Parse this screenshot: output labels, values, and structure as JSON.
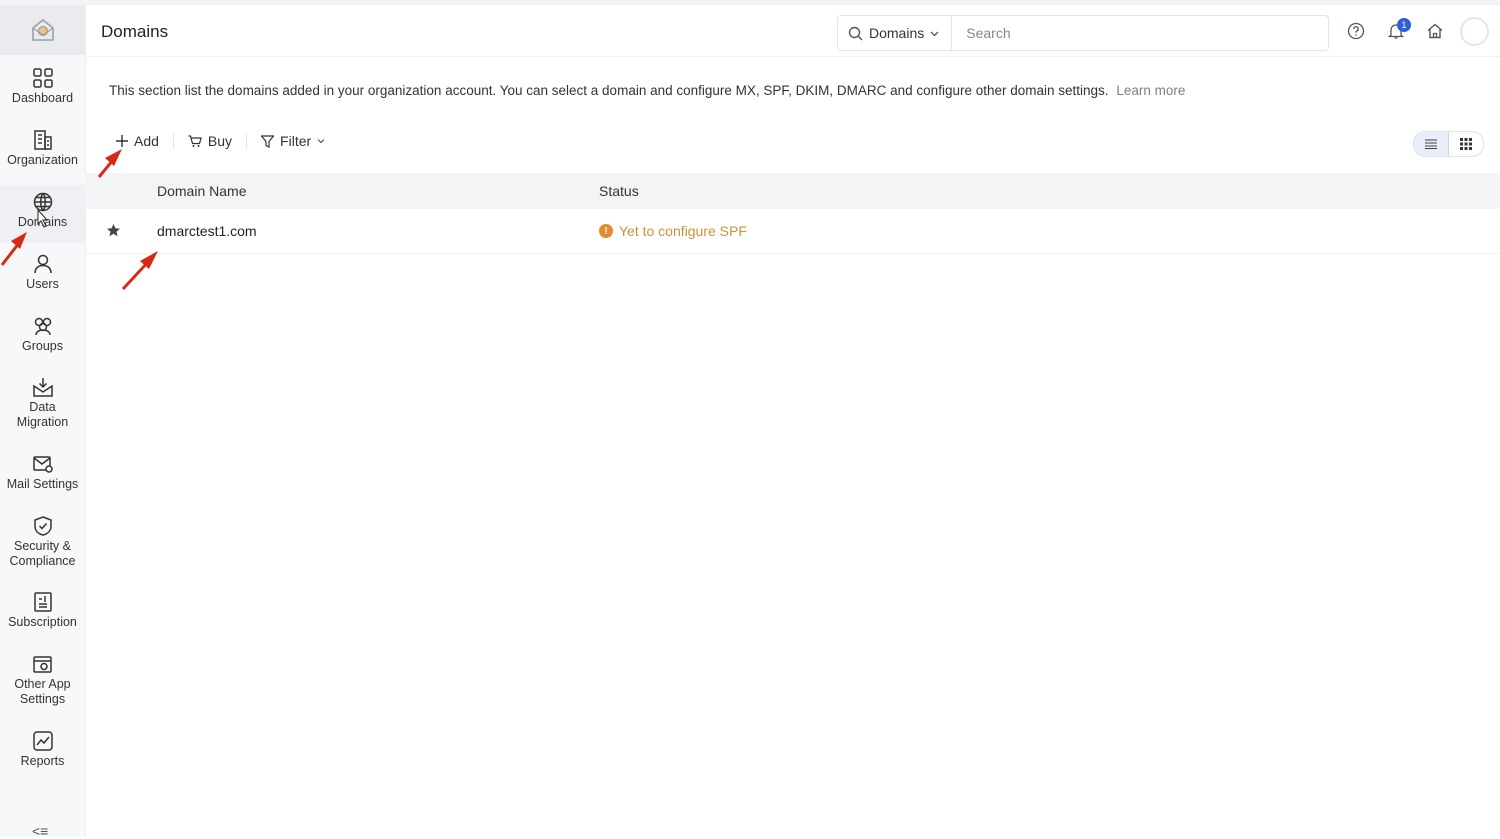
{
  "header": {
    "title": "Domains",
    "search_scope": "Domains",
    "search_placeholder": "Search",
    "notification_count": "1"
  },
  "sidebar": {
    "items": [
      {
        "label": "Dashboard",
        "icon": "dashboard-icon"
      },
      {
        "label": "Organization",
        "icon": "building-icon"
      },
      {
        "label": "Domains",
        "icon": "globe-icon"
      },
      {
        "label": "Users",
        "icon": "user-icon"
      },
      {
        "label": "Groups",
        "icon": "group-icon"
      },
      {
        "label": "Data Migration",
        "icon": "migration-icon"
      },
      {
        "label": "Mail Settings",
        "icon": "mail-settings-icon"
      },
      {
        "label": "Security & Compliance",
        "icon": "shield-icon"
      },
      {
        "label": "Subscription",
        "icon": "subscription-icon"
      },
      {
        "label": "Other App Settings",
        "icon": "app-settings-icon"
      },
      {
        "label": "Reports",
        "icon": "reports-icon"
      }
    ],
    "active": "Domains"
  },
  "main": {
    "description": "This section list the domains added in your organization account. You can select a domain and configure MX, SPF, DKIM, DMARC and configure other domain settings.",
    "learn_more": "Learn more",
    "toolbar": {
      "add": "Add",
      "buy": "Buy",
      "filter": "Filter"
    },
    "table": {
      "columns": [
        "Domain Name",
        "Status"
      ],
      "rows": [
        {
          "domain": "dmarctest1.com",
          "status": "Yet to configure SPF"
        }
      ]
    }
  },
  "colors": {
    "accent": "#2f5fd6",
    "status_warning": "#c9923a",
    "annotation_arrow": "#d42a17"
  }
}
